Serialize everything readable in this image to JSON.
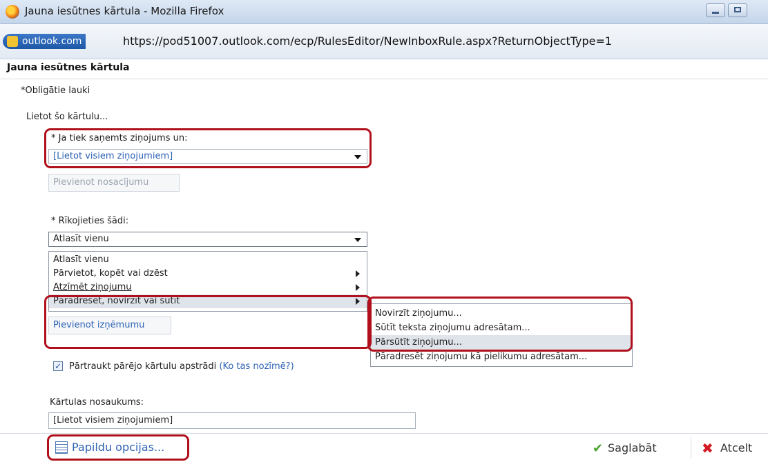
{
  "window": {
    "title": "Jauna iesūtnes kārtula - Mozilla Firefox"
  },
  "address_bar": {
    "site_badge": "outlook.com",
    "url": "https://pod51007.outlook.com/ecp/RulesEditor/NewInboxRule.aspx?ReturnObjectType=1"
  },
  "page": {
    "title": "Jauna iesūtnes kārtula",
    "required_note": "*Obligātie lauki",
    "apply_rule_label": "Lietot šo kārtulu..."
  },
  "condition": {
    "label": "* Ja tiek saņemts ziņojums un:",
    "selected": "[Lietot visiem ziņojumiem]",
    "add_condition_button": "Pievienot nosacījumu"
  },
  "action": {
    "label": "* Rīkojieties šādi:",
    "selected": "Atlasīt vienu",
    "menu_items": [
      {
        "label": "Atlasīt vienu"
      },
      {
        "label": "Pārvietot, kopēt vai dzēst"
      },
      {
        "label": "Atzīmēt ziņojumu"
      },
      {
        "label": "Pāradresēt, novirzīt vai sūtīt"
      }
    ],
    "submenu_items": [
      {
        "label": "Novirzīt ziņojumu..."
      },
      {
        "label": "Sūtīt teksta ziņojumu adresātam..."
      },
      {
        "label": "Pārsūtīt ziņojumu..."
      },
      {
        "label": "Pāradresēt ziņojumu kā pielikumu adresātam..."
      }
    ],
    "add_exception_button": "Pievienot izņēmumu"
  },
  "stop_processing": {
    "checked": true,
    "label": "Pārtraukt pārējo kārtulu apstrādi",
    "help_link": "(Ko tas nozīmē?)"
  },
  "rule_name": {
    "label": "Kārtulas nosaukums:",
    "value": "[Lietot visiem ziņojumiem]"
  },
  "footer": {
    "more_options": "Papildu opcijas...",
    "save": "Saglabāt",
    "cancel": "Atcelt"
  }
}
